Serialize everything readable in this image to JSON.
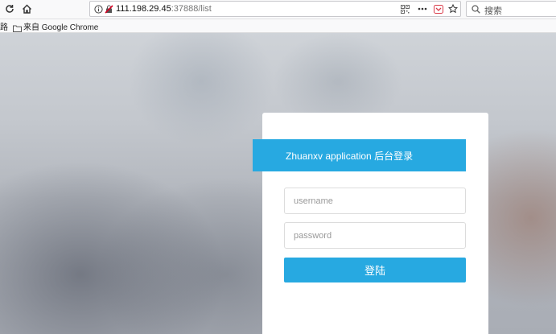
{
  "browser": {
    "url_host": "111.198.29.45",
    "url_path": ":37888/list",
    "search_placeholder": "搜索",
    "bookmark_overflow": "路",
    "bookmark_label": "来自 Google Chrome"
  },
  "login": {
    "title": "Zhuanxv application 后台登录",
    "username_placeholder": "username",
    "password_placeholder": "password",
    "submit_label": "登陆"
  },
  "colors": {
    "accent": "#27a9e1"
  }
}
